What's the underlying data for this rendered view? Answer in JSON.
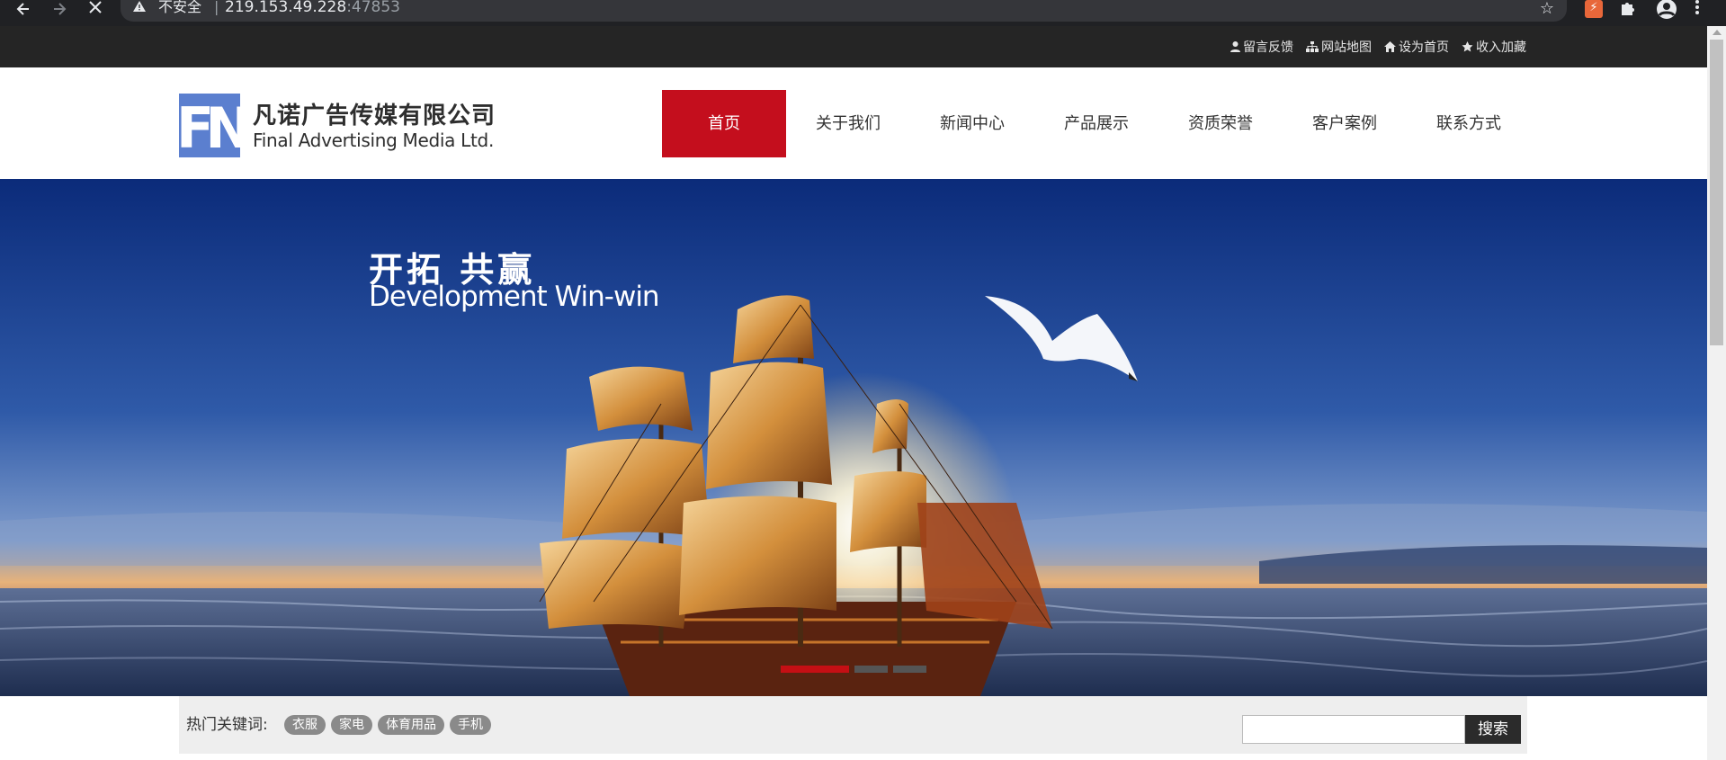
{
  "browser": {
    "security_warning": "不安全",
    "url_host": "219.153.49.228",
    "url_port": ":47853",
    "icons": [
      "back-arrow-icon",
      "forward-arrow-icon",
      "stop-loading-icon",
      "warning-icon",
      "bookmark-star-icon",
      "extension-icon",
      "puzzle-icon",
      "profile-icon",
      "more-menu-icon"
    ]
  },
  "topbar": {
    "links": [
      {
        "label": "留言反馈",
        "icon": "user-icon"
      },
      {
        "label": "网站地图",
        "icon": "sitemap-icon"
      },
      {
        "label": "设为首页",
        "icon": "home-icon"
      },
      {
        "label": "收入加藏",
        "icon": "star-icon"
      }
    ]
  },
  "header": {
    "logo_mark": "FN",
    "company_cn": "凡诺广告传媒有限公司",
    "company_en": "Final Advertising Media Ltd.",
    "nav": [
      {
        "label": "首页",
        "active": true
      },
      {
        "label": "关于我们",
        "active": false
      },
      {
        "label": "新闻中心",
        "active": false
      },
      {
        "label": "产品展示",
        "active": false
      },
      {
        "label": "资质荣誉",
        "active": false
      },
      {
        "label": "客户案例",
        "active": false
      },
      {
        "label": "联系方式",
        "active": false
      }
    ]
  },
  "banner": {
    "slogan_cn": "开拓 共赢",
    "slogan_en": "Development Win-win",
    "slides": 3,
    "active_slide": 1
  },
  "hot": {
    "label": "热门关键词:",
    "tags": [
      "衣服",
      "家电",
      "体育用品",
      "手机"
    ],
    "search_placeholder": "",
    "search_button": "搜索"
  },
  "colors": {
    "accent_red": "#c40e1d",
    "topbar_bg": "#252525",
    "logo_blue": "#5b7fcf"
  }
}
